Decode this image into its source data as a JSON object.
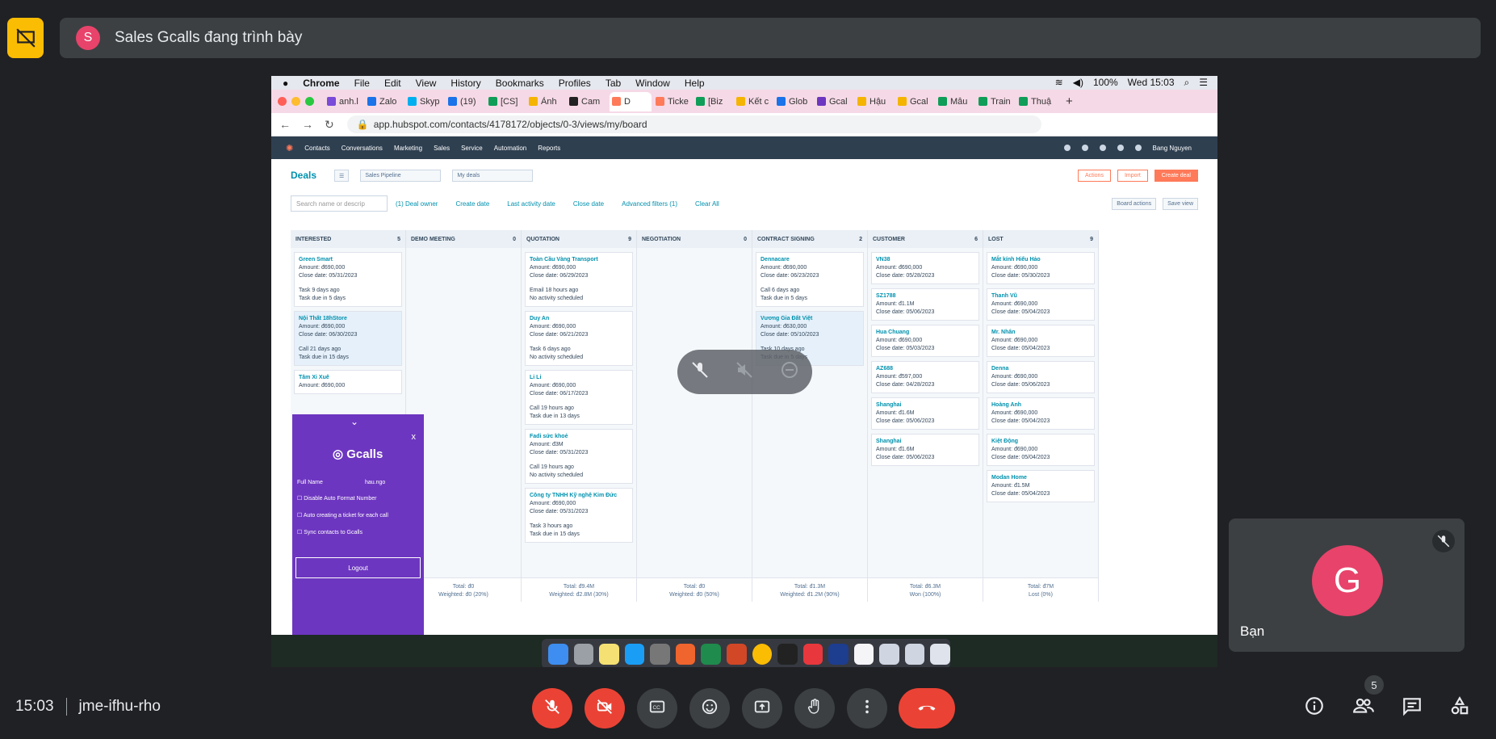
{
  "presenter": {
    "avatar_letter": "S",
    "text": "Sales Gcalls đang trình bày"
  },
  "mac_menu": {
    "items": [
      "Chrome",
      "File",
      "Edit",
      "View",
      "History",
      "Bookmarks",
      "Profiles",
      "Tab",
      "Window",
      "Help"
    ],
    "battery": "100%",
    "clock": "Wed 15:03"
  },
  "browser": {
    "tabs": [
      "anh.l",
      "Zalo",
      "Skyp",
      "(19)",
      "[CS]",
      "Ảnh",
      "Cam",
      "D",
      "Ticke",
      "[Biz",
      "Kết c",
      "Glob",
      "Gcal",
      "Hậu",
      "Gcal",
      "Mẫu",
      "Train",
      "Thuậ"
    ],
    "active_tab": 7,
    "url": "app.hubspot.com/contacts/4178172/objects/0-3/views/my/board"
  },
  "hubspot": {
    "nav": [
      "Contacts",
      "Conversations",
      "Marketing",
      "Sales",
      "Service",
      "Automation",
      "Reports"
    ],
    "user": "Bang Nguyen",
    "title": "Deals",
    "pipeline": "Sales Pipeline",
    "view": "My deals",
    "actions": "Actions",
    "import": "Import",
    "create_deal": "Create deal",
    "search_placeholder": "Search name or descrip",
    "filters": [
      "(1) Deal owner",
      "Create date",
      "Last activity date",
      "Close date",
      "Advanced filters (1)",
      "Clear All"
    ],
    "board_actions": "Board actions",
    "save_view": "Save view",
    "columns": [
      {
        "name": "INTERESTED",
        "count": "5",
        "cards": [
          {
            "name": "Green Smart",
            "amount": "Amount: đ690,000",
            "close": "Close date: 05/31/2023",
            "act1": "Task 9 days ago",
            "act2": "Task due in 5 days"
          },
          {
            "name": "Nội Thất 18hStore",
            "amount": "Amount: đ690,000",
            "close": "Close date: 06/30/2023",
            "act1": "Call 21 days ago",
            "act2": "Task due in 15 days"
          },
          {
            "name": "Tâm Xi Xuê",
            "amount": "Amount: đ690,000",
            "close": "",
            "act1": "",
            "act2": ""
          }
        ],
        "total": "",
        "weighted": ""
      },
      {
        "name": "DEMO MEETING",
        "count": "0",
        "cards": [],
        "total": "Total: đ0",
        "weighted": "Weighted: đ0 (20%)"
      },
      {
        "name": "QUOTATION",
        "count": "9",
        "cards": [
          {
            "name": "Toàn Cầu Vàng Transport",
            "amount": "Amount: đ690,000",
            "close": "Close date: 06/29/2023",
            "act1": "Email 18 hours ago",
            "act2": "No activity scheduled"
          },
          {
            "name": "Duy An",
            "amount": "Amount: đ690,000",
            "close": "Close date: 06/21/2023",
            "act1": "Task 6 days ago",
            "act2": "No activity scheduled"
          },
          {
            "name": "Li Li",
            "amount": "Amount: đ690,000",
            "close": "Close date: 06/17/2023",
            "act1": "Call 19 hours ago",
            "act2": "Task due in 13 days"
          },
          {
            "name": "Fadi sức khoẻ",
            "amount": "Amount: đ3M",
            "close": "Close date: 05/31/2023",
            "act1": "Call 19 hours ago",
            "act2": "No activity scheduled"
          },
          {
            "name": "Công ty TNHH Kỹ nghệ Kim Đức",
            "amount": "Amount: đ690,000",
            "close": "Close date: 05/31/2023",
            "act1": "Task 3 hours ago",
            "act2": "Task due in 15 days"
          }
        ],
        "total": "Total: đ9.4M",
        "weighted": "Weighted: đ2.8M (30%)"
      },
      {
        "name": "NEGOTIATION",
        "count": "0",
        "cards": [],
        "total": "Total: đ0",
        "weighted": "Weighted: đ0 (50%)"
      },
      {
        "name": "CONTRACT SIGNING",
        "count": "2",
        "cards": [
          {
            "name": "Dennacare",
            "amount": "Amount: đ690,000",
            "close": "Close date: 06/23/2023",
            "act1": "Call 6 days ago",
            "act2": "Task due in 5 days"
          },
          {
            "name": "Vương Gia Đất Việt",
            "amount": "Amount: đ630,000",
            "close": "Close date: 05/10/2023",
            "act1": "Task 10 days ago",
            "act2": "Task due in 5 days"
          }
        ],
        "total": "Total: đ1.3M",
        "weighted": "Weighted: đ1.2M (90%)"
      },
      {
        "name": "CUSTOMER",
        "count": "6",
        "cards": [
          {
            "name": "VN38",
            "amount": "Amount: đ690,000",
            "close": "Close date: 05/28/2023",
            "act1": "",
            "act2": ""
          },
          {
            "name": "SZ1788",
            "amount": "Amount: đ1.1M",
            "close": "Close date: 05/06/2023",
            "act1": "",
            "act2": ""
          },
          {
            "name": "Hua Chuang",
            "amount": "Amount: đ690,000",
            "close": "Close date: 05/03/2023",
            "act1": "",
            "act2": ""
          },
          {
            "name": "AZ688",
            "amount": "Amount: đ597,000",
            "close": "Close date: 04/28/2023",
            "act1": "",
            "act2": ""
          },
          {
            "name": "Shanghai",
            "amount": "Amount: đ1.6M",
            "close": "Close date: 05/06/2023",
            "act1": "",
            "act2": ""
          },
          {
            "name": "Shanghai",
            "amount": "Amount: đ1.6M",
            "close": "Close date: 05/06/2023",
            "act1": "",
            "act2": ""
          }
        ],
        "total": "Total: đ6.3M",
        "weighted": "Won (100%)"
      },
      {
        "name": "LOST",
        "count": "9",
        "cards": [
          {
            "name": "Mắt kính Hiếu Hảo",
            "amount": "Amount: đ690,000",
            "close": "Close date: 05/30/2023",
            "act1": "",
            "act2": ""
          },
          {
            "name": "Thanh Vũ",
            "amount": "Amount: đ690,000",
            "close": "Close date: 05/04/2023",
            "act1": "",
            "act2": ""
          },
          {
            "name": "Mr. Nhân",
            "amount": "Amount: đ690,000",
            "close": "Close date: 05/04/2023",
            "act1": "",
            "act2": ""
          },
          {
            "name": "Denna",
            "amount": "Amount: đ690,000",
            "close": "Close date: 05/06/2023",
            "act1": "",
            "act2": ""
          },
          {
            "name": "Hoàng Anh",
            "amount": "Amount: đ690,000",
            "close": "Close date: 05/04/2023",
            "act1": "",
            "act2": ""
          },
          {
            "name": "Kiệt Động",
            "amount": "Amount: đ690,000",
            "close": "Close date: 05/04/2023",
            "act1": "",
            "act2": ""
          },
          {
            "name": "Modan Home",
            "amount": "Amount: đ1.5M",
            "close": "Close date: 05/04/2023",
            "act1": "",
            "act2": ""
          }
        ],
        "total": "Total: đ7M",
        "weighted": "Lost (0%)"
      }
    ]
  },
  "gcalls": {
    "brand": "Gcalls",
    "close": "x",
    "full_name_label": "Full Name",
    "full_name_value": "hau.ngo",
    "options": [
      "Disable Auto Format Number",
      "Auto creating a ticket for each call",
      "Sync contacts to Gcalls"
    ],
    "logout": "Logout"
  },
  "self_tile": {
    "avatar_letter": "G",
    "name": "Bạn"
  },
  "meeting": {
    "time": "15:03",
    "code": "jme-ifhu-rho",
    "participants": "5"
  },
  "colors": {
    "bg": "#202124",
    "tile": "#3c4043",
    "red": "#ea4335",
    "accent_yellow": "#fbbc04",
    "avatar_pink": "#e8436a",
    "hubspot_orange": "#ff7a59",
    "gcalls_purple": "#6d36c0"
  }
}
